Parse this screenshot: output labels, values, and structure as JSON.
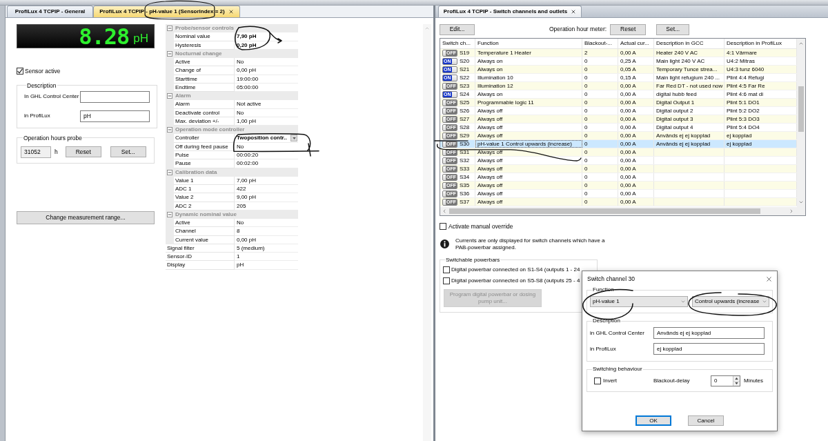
{
  "left_panel": {
    "tabs": [
      {
        "label": "ProfiLux 4 TCPIP - General",
        "selected": false
      },
      {
        "label": "ProfiLux 4 TCPIP - pH-value 1 (Sensorindex = 2)",
        "selected": true
      }
    ],
    "display": {
      "value": "8.28",
      "unit": "pH"
    },
    "sensor_active": {
      "label": "Sensor active",
      "checked": true
    },
    "description": {
      "title": "Description",
      "fields": [
        {
          "label": "In GHL Control Center"
        },
        {
          "label": "in ProfiLux",
          "value": "pH"
        }
      ]
    },
    "operation_hours": {
      "title": "Operation hours probe",
      "value": "31052",
      "unit": "h",
      "buttons": [
        "Reset",
        "Set..."
      ]
    },
    "range_button": "Change measurement range...",
    "properties": {
      "groups": [
        {
          "title": "Probe/sensor controls",
          "expanded": true,
          "rows": [
            {
              "name": "Nominal value",
              "value": "7,90 pH",
              "kind": "text",
              "modified": true
            },
            {
              "name": "Hysteresis",
              "value": "0,20 pH",
              "kind": "text",
              "modified": true
            }
          ]
        },
        {
          "title": "Nocturnal change",
          "expanded": true,
          "rows": [
            {
              "name": "Active",
              "value": "No",
              "kind": "text",
              "modified": false
            },
            {
              "name": "Change of",
              "value": "0,00 pH",
              "kind": "text",
              "modified": false
            },
            {
              "name": "Starttime",
              "value": "19:00:00",
              "kind": "text",
              "modified": false
            },
            {
              "name": "Endtime",
              "value": "05:00:00",
              "kind": "text",
              "modified": false
            }
          ]
        },
        {
          "title": "Alarm",
          "expanded": true,
          "rows": [
            {
              "name": "Alarm",
              "value": "Not active",
              "kind": "text",
              "modified": false
            },
            {
              "name": "Deactivate control",
              "value": "No",
              "kind": "text",
              "modified": false
            },
            {
              "name": "Max. deviation +/-",
              "value": "1,00 pH",
              "kind": "text",
              "modified": false
            }
          ]
        },
        {
          "title": "Operation mode controller",
          "expanded": true,
          "rows": [
            {
              "name": "Controller",
              "value": "Twoposition contr..",
              "kind": "dropdown",
              "modified": true
            },
            {
              "name": "Off during feed pause",
              "value": "No",
              "kind": "text",
              "modified": false
            },
            {
              "name": "Pulse",
              "value": "00:00:20",
              "kind": "text",
              "modified": false
            },
            {
              "name": "Pause",
              "value": "00:02:00",
              "kind": "text",
              "modified": false
            }
          ]
        },
        {
          "title": "Calibration data",
          "expanded": true,
          "rows": [
            {
              "name": "Value 1",
              "value": "7,00 pH",
              "kind": "text",
              "modified": false
            },
            {
              "name": "ADC 1",
              "value": "422",
              "kind": "text",
              "modified": false
            },
            {
              "name": "Value 2",
              "value": "9,00 pH",
              "kind": "text",
              "modified": false
            },
            {
              "name": "ADC 2",
              "value": "205",
              "kind": "text",
              "modified": false
            }
          ]
        },
        {
          "title": "Dynamic nominal value",
          "expanded": true,
          "rows": [
            {
              "name": "Active",
              "value": "No",
              "kind": "text",
              "modified": false
            },
            {
              "name": "Channel",
              "value": "8",
              "kind": "text",
              "modified": false
            },
            {
              "name": "Current value",
              "value": "0,00 pH",
              "kind": "text",
              "modified": false
            }
          ]
        }
      ],
      "rows": [
        {
          "name": "Signal filter",
          "value": "5 (medium)",
          "kind": "text",
          "modified": false
        },
        {
          "name": "Sensor-ID",
          "value": "1",
          "kind": "text",
          "modified": false
        },
        {
          "name": "Display",
          "value": "pH",
          "kind": "text",
          "modified": false
        }
      ]
    }
  },
  "right_panel": {
    "tabs": [
      {
        "label": "ProfiLux 4 TCPIP - Switch channels and outlets",
        "selected": true
      }
    ],
    "toolbar": {
      "edit": "Edit...",
      "meter_label": "Operation hour meter:",
      "buttons": [
        "Reset",
        "Set..."
      ]
    },
    "table": {
      "columns": [
        "Switch ch...",
        "Function",
        "Blackout-...",
        "Actual cur...",
        "Description in GCC",
        "Description in ProfiLux"
      ],
      "rows": [
        {
          "toggle": "OFF",
          "on": false,
          "channel": "S19",
          "function": "Temperature 1 Heater",
          "blackout": "2",
          "current": "0,00 A",
          "description_gcc": "Heater 240 V AC",
          "description_profilux": "4:1 Värmare",
          "selected": false
        },
        {
          "toggle": "ON",
          "on": true,
          "channel": "S20",
          "function": "Always on",
          "blackout": "0",
          "current": "0,25 A",
          "description_gcc": "Main light 240 V AC",
          "description_profilux": "U4:2 Mitras",
          "selected": false
        },
        {
          "toggle": "ON",
          "on": true,
          "channel": "S21",
          "function": "Always on",
          "blackout": "0",
          "current": "0,05 A",
          "description_gcc": "Temporary Tunce strea...",
          "description_profilux": "U4:3 tunz 6040",
          "selected": false
        },
        {
          "toggle": "ON",
          "on": true,
          "channel": "S22",
          "function": "Illumination 10",
          "blackout": "0",
          "current": "0,15 A",
          "description_gcc": "Main light refugium 240 ...",
          "description_profilux": "Plint 4:4 Refugi",
          "selected": false
        },
        {
          "toggle": "OFF",
          "on": false,
          "channel": "S23",
          "function": "Illumination 12",
          "blackout": "0",
          "current": "0,00 A",
          "description_gcc": "Far Red DT - not used now",
          "description_profilux": "Plint 4:5 Far Re",
          "selected": false
        },
        {
          "toggle": "ON",
          "on": true,
          "channel": "S24",
          "function": "Always on",
          "blackout": "0",
          "current": "0,00 A",
          "description_gcc": "digital hubb feed",
          "description_profilux": "Plint 4:6 mat di",
          "selected": false
        },
        {
          "toggle": "OFF",
          "on": false,
          "channel": "S25",
          "function": "Programmable logic 11",
          "blackout": "0",
          "current": "0,00 A",
          "description_gcc": "Digital Output 1",
          "description_profilux": "Plint 5:1 DO1",
          "selected": false
        },
        {
          "toggle": "OFF",
          "on": false,
          "channel": "S26",
          "function": "Always off",
          "blackout": "0",
          "current": "0,00 A",
          "description_gcc": "Digital output 2",
          "description_profilux": "Plint 5:2 DO2",
          "selected": false
        },
        {
          "toggle": "OFF",
          "on": false,
          "channel": "S27",
          "function": "Always off",
          "blackout": "0",
          "current": "0,00 A",
          "description_gcc": "Digital output 3",
          "description_profilux": "Plint 5:3 DO3",
          "selected": false
        },
        {
          "toggle": "OFF",
          "on": false,
          "channel": "S28",
          "function": "Always off",
          "blackout": "0",
          "current": "0,00 A",
          "description_gcc": "Digital output 4",
          "description_profilux": "Plint 5:4 DO4",
          "selected": false
        },
        {
          "toggle": "OFF",
          "on": false,
          "channel": "S29",
          "function": "Always off",
          "blackout": "0",
          "current": "0,00 A",
          "description_gcc": "Används ej ej kopplad",
          "description_profilux": "ej kopplad",
          "selected": false
        },
        {
          "toggle": "OFF",
          "on": false,
          "channel": "S30",
          "function": "pH-value 1 Control upwards (increase)",
          "blackout": "0",
          "current": "0,00 A",
          "description_gcc": "Används ej ej kopplad",
          "description_profilux": "ej kopplad",
          "selected": true
        },
        {
          "toggle": "OFF",
          "on": false,
          "channel": "S31",
          "function": "Always off",
          "blackout": "0",
          "current": "0,00 A",
          "selected": false
        },
        {
          "toggle": "OFF",
          "on": false,
          "channel": "S32",
          "function": "Always off",
          "blackout": "0",
          "current": "0,00 A",
          "selected": false
        },
        {
          "toggle": "OFF",
          "on": false,
          "channel": "S33",
          "function": "Always off",
          "blackout": "0",
          "current": "0,00 A",
          "selected": false
        },
        {
          "toggle": "OFF",
          "on": false,
          "channel": "S34",
          "function": "Always off",
          "blackout": "0",
          "current": "0,00 A",
          "selected": false
        },
        {
          "toggle": "OFF",
          "on": false,
          "channel": "S35",
          "function": "Always off",
          "blackout": "0",
          "current": "0,00 A",
          "selected": false
        },
        {
          "toggle": "OFF",
          "on": false,
          "channel": "S36",
          "function": "Always off",
          "blackout": "0",
          "current": "0,00 A",
          "selected": false
        },
        {
          "toggle": "OFF",
          "on": false,
          "channel": "S37",
          "function": "Always off",
          "blackout": "0",
          "current": "0,00 A",
          "selected": false
        }
      ]
    },
    "manual_override": {
      "label": "Activate manual override",
      "checked": false
    },
    "note": "Currents are only displayed for switch channels which have a PAB-powerbar assigned.",
    "powerbars": {
      "title": "Switchable powerbars",
      "options": [
        {
          "label": "Digital powerbar connected on S1-S4 (outputs 1 - 24",
          "checked": false
        },
        {
          "label": "Digital powerbar connected on S5-S8 (outputs 25 - 4",
          "checked": false
        }
      ],
      "program_button": {
        "label": "Program digital powerbar or dosing pump unit...",
        "disabled": true
      }
    }
  },
  "dialog": {
    "title": "Switch channel 30",
    "function": {
      "title": "Function",
      "selects": [
        "pH-value 1",
        "Control upwards (increase"
      ]
    },
    "description": {
      "title": "Description",
      "fields": [
        {
          "label": "in GHL Control Center",
          "value": "Används ej ej kopplad"
        },
        {
          "label": "in ProfiLux",
          "value": "ej kopplad"
        }
      ]
    },
    "switching": {
      "title": "Switching behaviour",
      "invert": {
        "label": "Invert",
        "checked": false
      },
      "delay_label": "Blackout-delay",
      "delay_value": "0",
      "delay_unit": "Minutes"
    },
    "buttons": [
      {
        "label": "OK",
        "default": true
      },
      {
        "label": "Cancel",
        "default": false
      }
    ]
  }
}
